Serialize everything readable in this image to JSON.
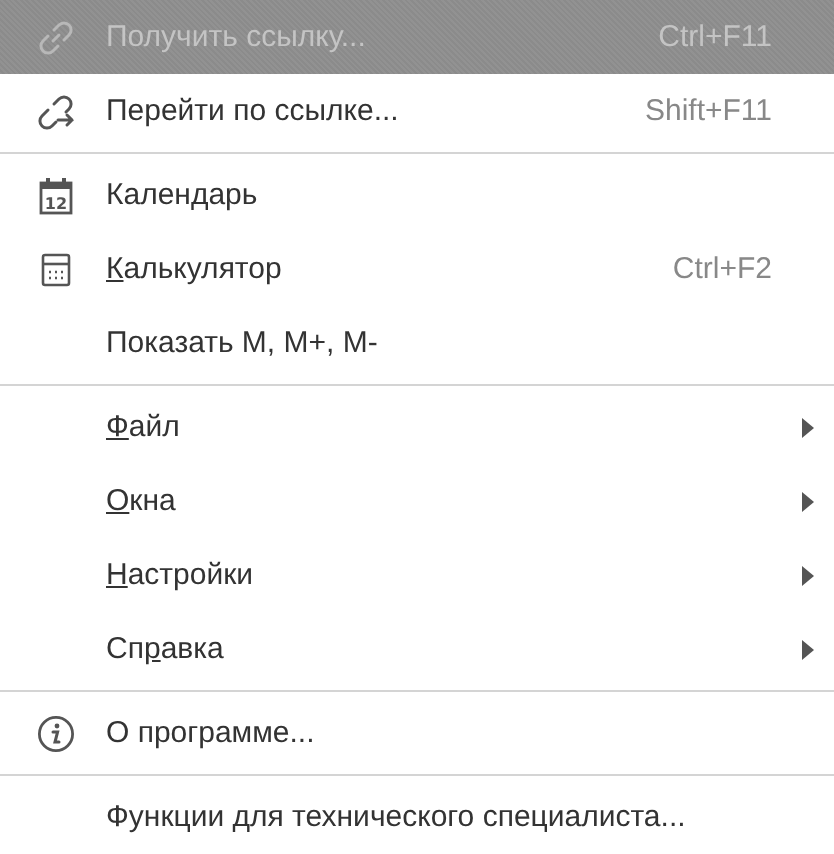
{
  "menu": {
    "groups": [
      {
        "items": [
          {
            "kind": "link-command",
            "label": "Получить ссылку...",
            "shortcut": "Ctrl+F11",
            "highlighted": true,
            "disabled": true
          },
          {
            "kind": "link-arrow-command",
            "label": "Перейти по ссылке...",
            "shortcut": "Shift+F11",
            "highlighted": false,
            "disabled": false
          }
        ]
      },
      {
        "items": [
          {
            "kind": "calendar-command",
            "icon_label": "12",
            "label": "Календарь",
            "highlighted": false,
            "disabled": false
          },
          {
            "kind": "calculator-command",
            "label_parts": [
              {
                "text": "К",
                "underlined": true
              },
              {
                "text": "алькулятор",
                "underlined": false
              }
            ],
            "shortcut": "Ctrl+F2",
            "highlighted": false,
            "disabled": false
          },
          {
            "kind": "command",
            "label": "Показать M, M+, M-",
            "highlighted": false,
            "disabled": false
          }
        ]
      },
      {
        "items": [
          {
            "kind": "submenu",
            "label_parts": [
              {
                "text": "Ф",
                "underlined": true
              },
              {
                "text": "айл",
                "underlined": false
              }
            ],
            "highlighted": false,
            "disabled": false
          },
          {
            "kind": "submenu",
            "label_parts": [
              {
                "text": "О",
                "underlined": true
              },
              {
                "text": "кна",
                "underlined": false
              }
            ],
            "highlighted": false,
            "disabled": false
          },
          {
            "kind": "submenu",
            "label_parts": [
              {
                "text": "Н",
                "underlined": true
              },
              {
                "text": "астройки",
                "underlined": false
              }
            ],
            "highlighted": false,
            "disabled": false
          },
          {
            "kind": "submenu",
            "label_parts": [
              {
                "text": "Сп",
                "underlined": false
              },
              {
                "text": "р",
                "underlined": true
              },
              {
                "text": "авка",
                "underlined": false
              }
            ],
            "highlighted": false,
            "disabled": false
          }
        ]
      },
      {
        "items": [
          {
            "kind": "info-command",
            "label": "О программе...",
            "highlighted": false,
            "disabled": false
          }
        ]
      },
      {
        "items": [
          {
            "kind": "command",
            "label": "Функции для технического специалиста...",
            "highlighted": false,
            "disabled": false
          }
        ]
      }
    ]
  }
}
